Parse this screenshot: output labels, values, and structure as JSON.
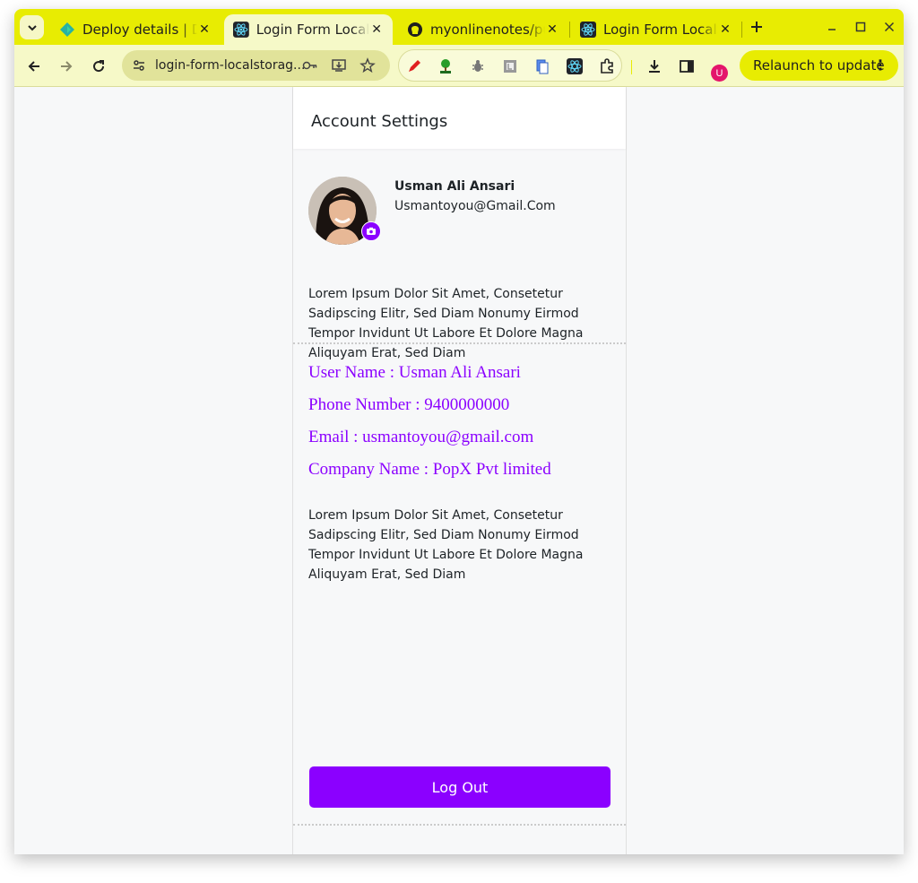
{
  "browser": {
    "tabs": [
      {
        "title": "Deploy details | Deploy",
        "active": false
      },
      {
        "title": "Login Form LocalStorage",
        "active": true
      },
      {
        "title": "myonlinenotes/public",
        "active": false
      },
      {
        "title": "Login Form LocalStorage",
        "active": false
      }
    ],
    "url": "login-form-localstorag...",
    "relaunch_label": "Relaunch to update",
    "profile_initial": "U",
    "accent": "#e8ec02"
  },
  "app": {
    "header_title": "Account Settings",
    "profile": {
      "name": "Usman Ali Ansari",
      "email": "Usmantoyou@Gmail.Com"
    },
    "bio_1": "Lorem Ipsum Dolor Sit Amet, Consetetur Sadipscing Elitr, Sed Diam Nonumy Eirmod Tempor Invidunt Ut Labore Et Dolore Magna Aliquyam Erat, Sed Diam",
    "details": {
      "username": "User Name : Usman Ali Ansari",
      "phone": "Phone Number : 9400000000",
      "email": "Email : usmantoyou@gmail.com",
      "company": "Company Name : PopX Pvt limited"
    },
    "bio_2": "Lorem Ipsum Dolor Sit Amet, Consetetur Sadipscing Elitr, Sed Diam Nonumy Eirmod Tempor Invidunt Ut Labore Et Dolore Magna Aliquyam Erat, Sed Diam",
    "logout_label": "Log Out",
    "accent": "#8b00ff"
  }
}
